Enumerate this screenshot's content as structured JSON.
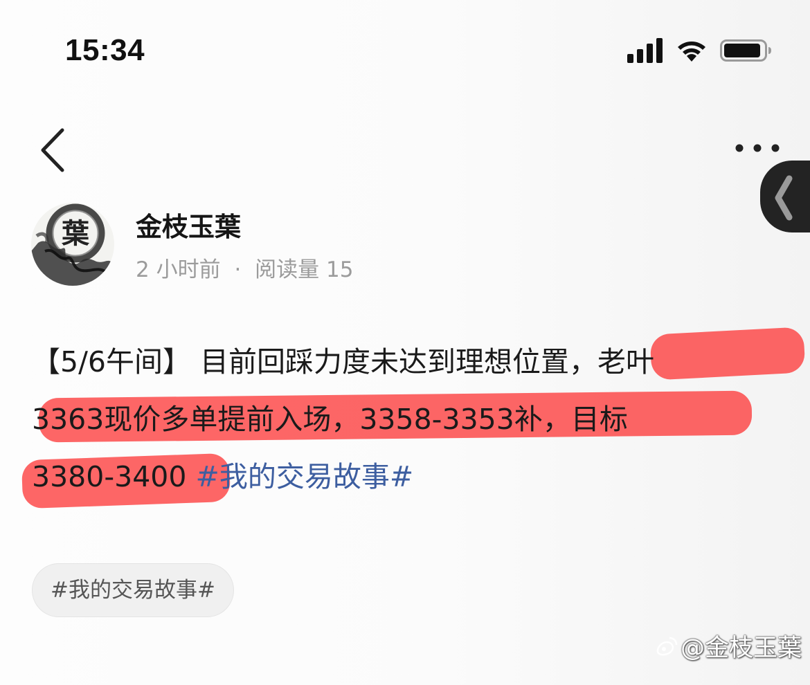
{
  "status_bar": {
    "time": "15:34",
    "signal_icon": "cellular-signal-icon",
    "wifi_icon": "wifi-icon",
    "battery_icon": "battery-icon"
  },
  "nav": {
    "back_icon": "chevron-left-icon",
    "more_icon": "more-horizontal-icon",
    "float_tab_icon": "chevron-left-icon"
  },
  "author": {
    "name": "金枝玉葉",
    "avatar_char": "葉"
  },
  "meta": {
    "time_ago": "2 小时前",
    "separator": "·",
    "read_count": "阅读量 15"
  },
  "post": {
    "line1": "【5/6午间】 目前回踩力度未达到理想位置，老叶",
    "line2": "3363现价多单提前入场，3358-3353补，目标",
    "line3_text": "3380-3400 ",
    "line3_hashtag": "#我的交易故事#",
    "highlight_color": "#fc3b3b",
    "hashtag_color": "#3d5ea0"
  },
  "tag": {
    "label": "#我的交易故事#"
  },
  "watermark": {
    "text": "@金枝玉葉"
  }
}
